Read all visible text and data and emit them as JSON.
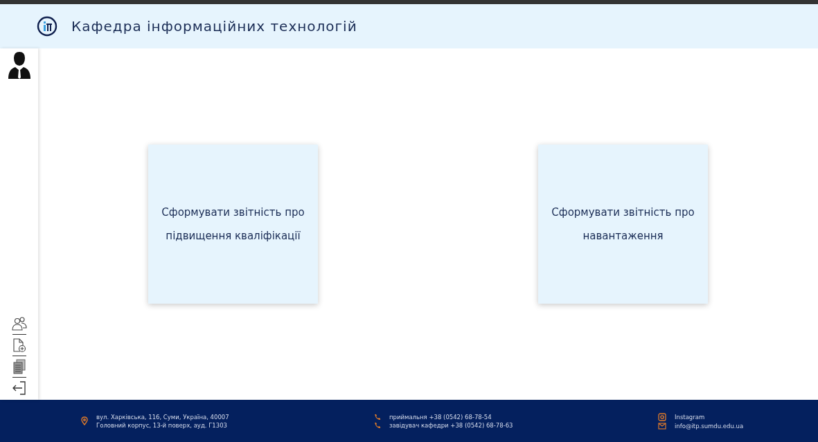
{
  "header": {
    "title": "Кафедра інформаційних технологій"
  },
  "cards": [
    {
      "label": "Сформувати звітність про підвищення кваліфікації"
    },
    {
      "label": "Сформувати звітність про навантаження"
    }
  ],
  "footer": {
    "address": [
      "вул. Харківська, 116, Суми, Україна, 40007",
      "Головний корпус, 13-й поверх, ауд. Г1303"
    ],
    "phones": [
      "приймальня +38 (0542) 68-78-54",
      "завідувач кафедри +38 (0542) 68-78-63"
    ],
    "instagram": "Instagram",
    "email": "info@itp.sumdu.edu.ua"
  }
}
